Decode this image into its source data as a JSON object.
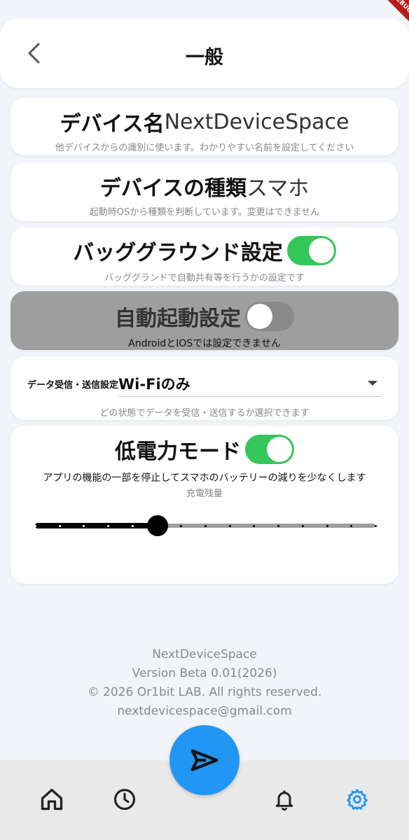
{
  "header": {
    "title": "一般"
  },
  "device_name": {
    "label": "デバイス名",
    "value": "NextDeviceSpace",
    "description": "他デバイスからの識別に使います。わかりやすい名前を設定してください"
  },
  "device_type": {
    "label": "デバイスの種類",
    "value": "スマホ",
    "description": "起動時OSから種類を判断しています。変更はできません"
  },
  "background": {
    "label": "バッググラウンド設定",
    "enabled": true,
    "description": "バッググランドで自動共有等を行うかの設定です"
  },
  "auto_start": {
    "label": "自動起動設定",
    "enabled": false,
    "description": "AndroidとIOSでは設定できません"
  },
  "data_transfer": {
    "label": "データ受信・送信設定",
    "selected": "Wi-Fiのみ",
    "description": "どの状態でデータを受信・送信するか選択できます"
  },
  "low_power": {
    "label": "低電力モード",
    "enabled": true,
    "description": "アプリの機能の一部を停止してスマホのバッテリーの減りを少なくします",
    "slider_label": "充電残量",
    "slider_value_fraction": 0.36,
    "slider_divisions": 14
  },
  "footer": {
    "app_name": "NextDeviceSpace",
    "version": "Version Beta 0.01(2026)",
    "copyright": "© 2026 Or1bit LAB. All rights reserved.",
    "email": "nextdevicespace@gmail.com"
  },
  "debug_banner": "DEBUG",
  "nav": {
    "items": [
      "home-icon",
      "history-icon",
      "bell-icon",
      "gear-icon"
    ],
    "active": "gear-icon",
    "accent": "#2196f3"
  },
  "colors": {
    "toggle_on": "#34c759",
    "fab": "#2196f3",
    "active_nav": "#2196f3"
  }
}
